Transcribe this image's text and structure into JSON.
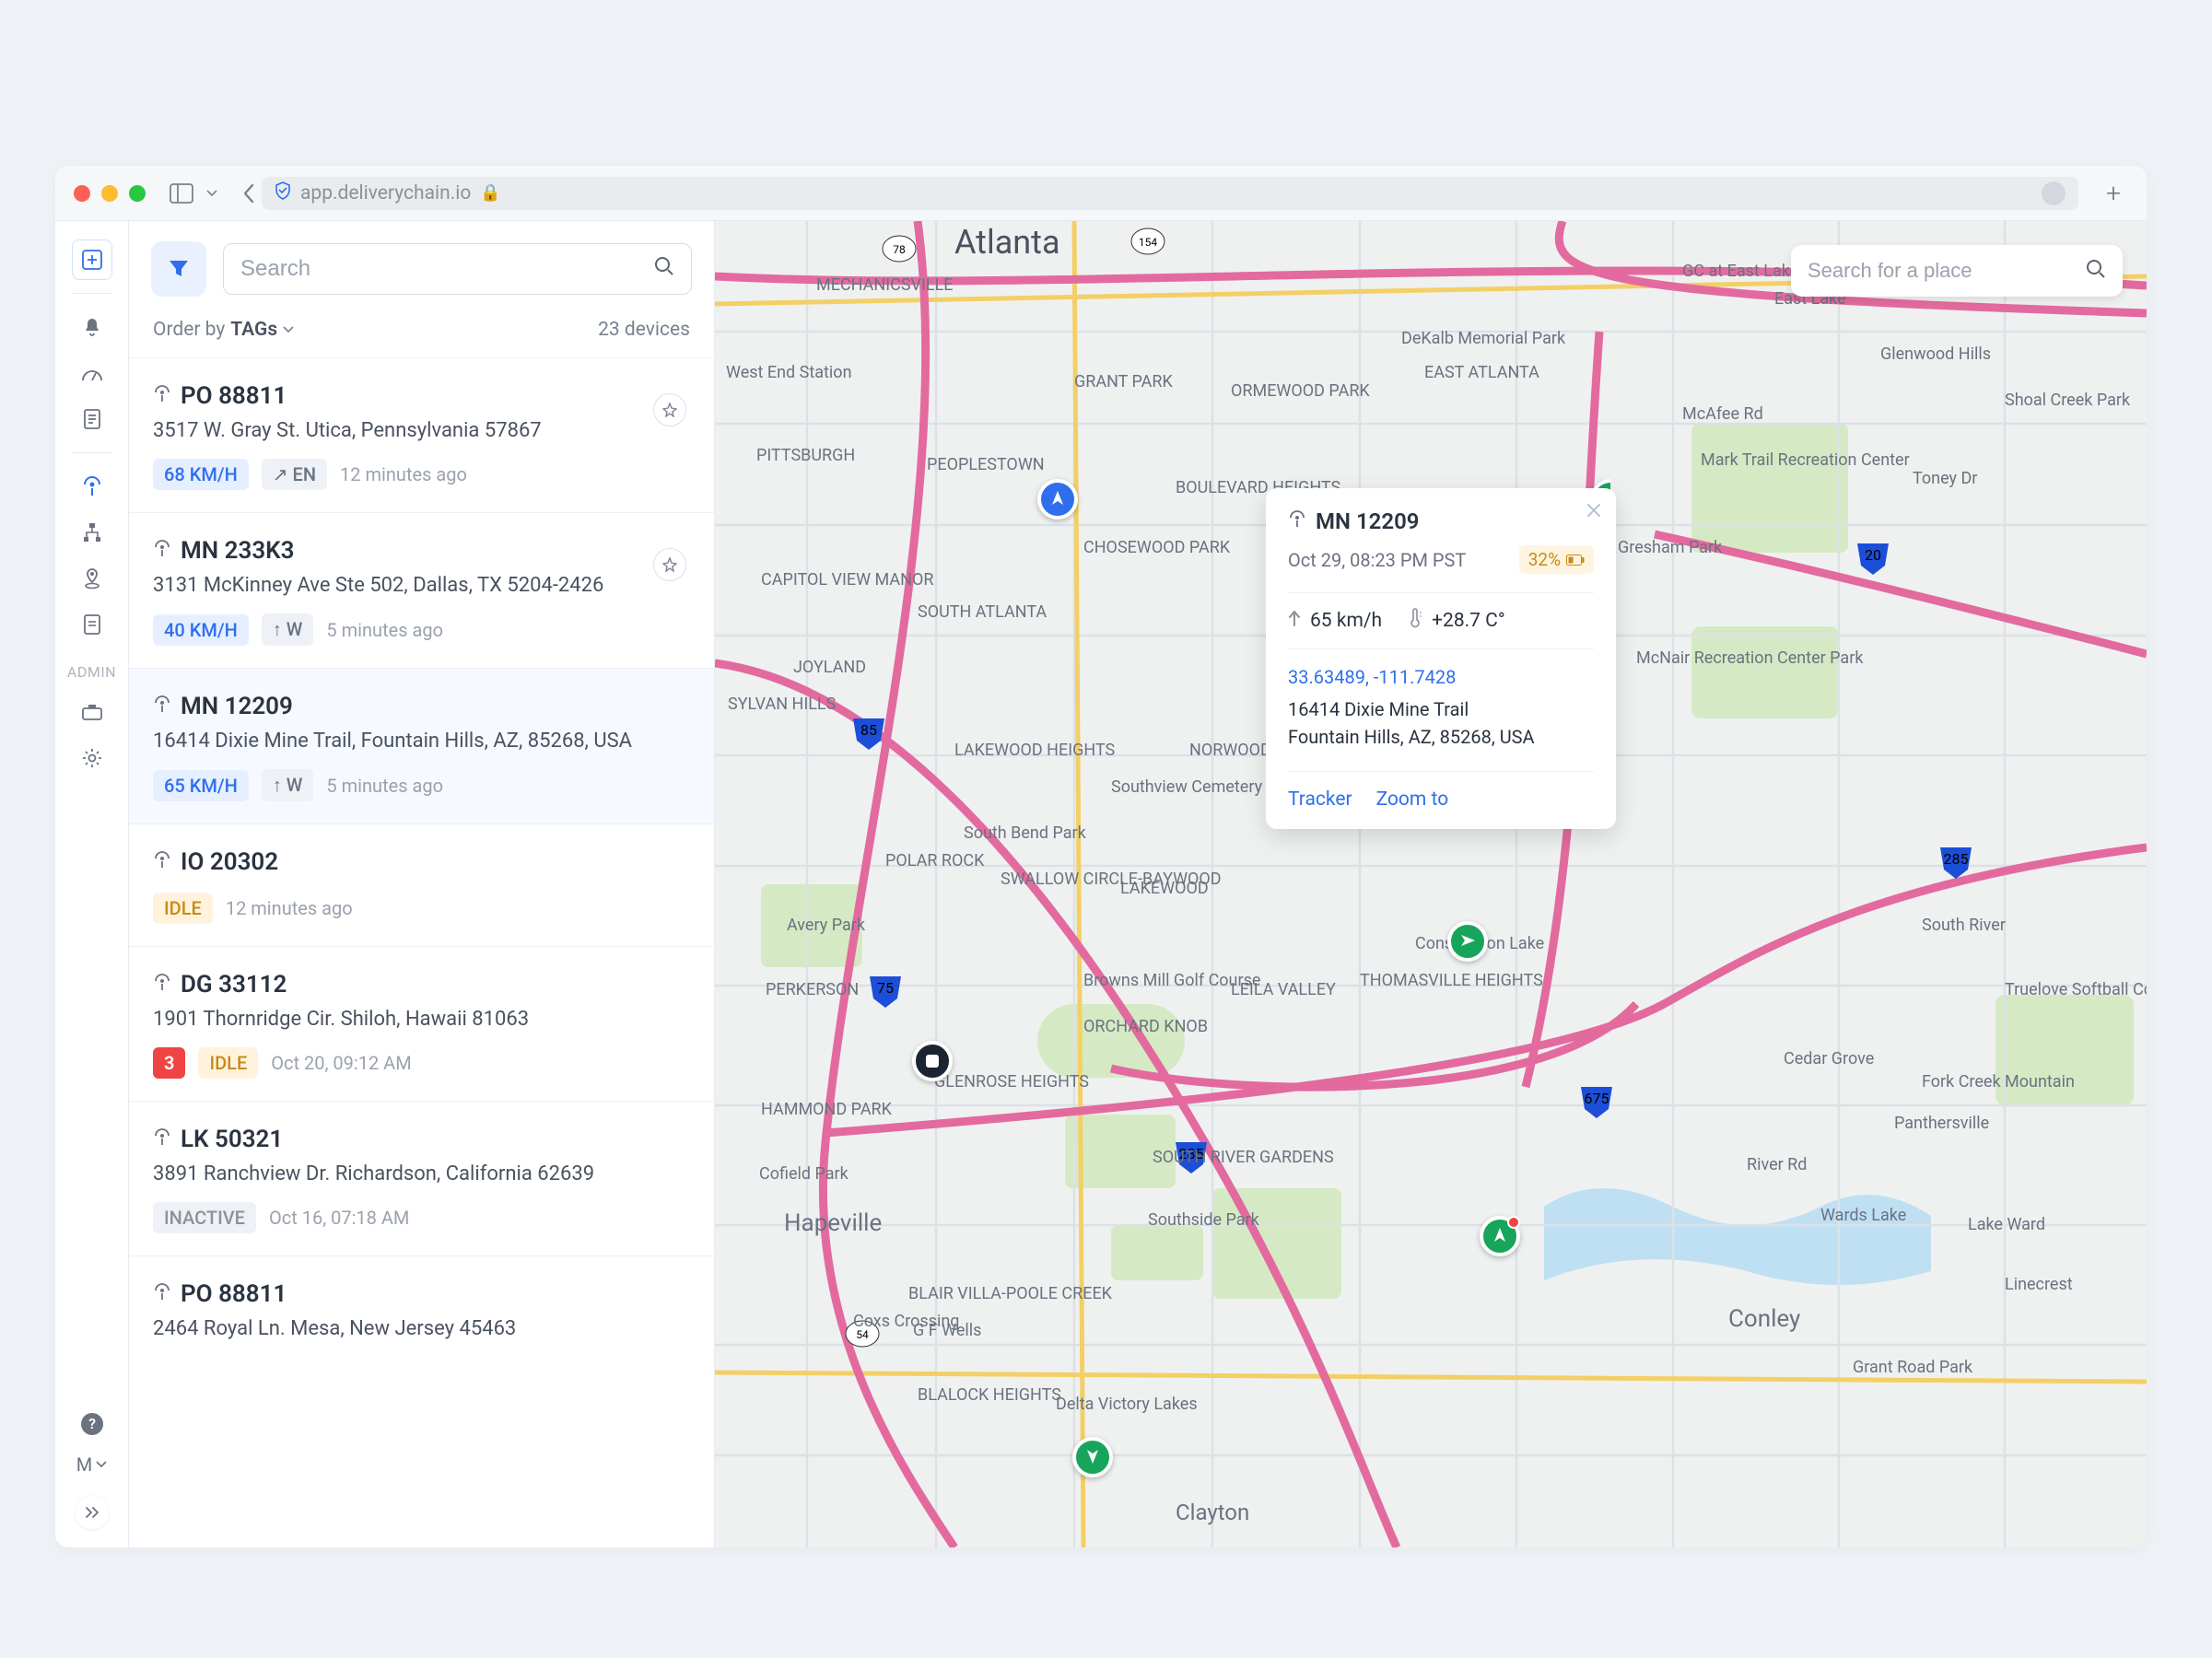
{
  "browser": {
    "url": "app.deliverychain.io"
  },
  "side": {
    "search_placeholder": "Search",
    "order_label": "Order by",
    "order_value": "TAGs",
    "device_count": "23 devices",
    "admin_label": "ADMIN",
    "user_initial": "M"
  },
  "map_search": {
    "placeholder": "Search for a place"
  },
  "devices": [
    {
      "id": "PO 88811",
      "addr": "3517 W. Gray St. Utica, Pennsylvania 57867",
      "speed": "68 KM/H",
      "dir": "↗ EN",
      "time": "12 minutes ago",
      "pin": true,
      "state": "moving"
    },
    {
      "id": "MN 233K3",
      "addr": "3131 McKinney Ave Ste 502, Dallas, TX 5204-2426",
      "speed": "40 KM/H",
      "dir": "↑ W",
      "time": "5 minutes ago",
      "pin": true,
      "state": "moving"
    },
    {
      "id": "MN 12209",
      "addr": "16414 Dixie Mine Trail, Fountain Hills, AZ, 85268, USA",
      "speed": "65 KM/H",
      "dir": "↑ W",
      "time": "5 minutes ago",
      "pin": false,
      "state": "moving",
      "selected": true
    },
    {
      "id": "IO 20302",
      "addr": "",
      "idle": "IDLE",
      "time": "12 minutes ago",
      "state": "idle"
    },
    {
      "id": "DG 33112",
      "addr": "1901 Thornridge Cir. Shiloh, Hawaii 81063",
      "alert": "3",
      "idle": "IDLE",
      "time": "Oct 20, 09:12 AM",
      "state": "idle"
    },
    {
      "id": "LK 50321",
      "addr": "3891 Ranchview Dr. Richardson, California 62639",
      "inactive": "INACTIVE",
      "time": "Oct 16, 07:18 AM",
      "state": "inactive"
    },
    {
      "id": "PO 88811",
      "addr": "2464 Royal Ln. Mesa, New Jersey 45463",
      "state": ""
    }
  ],
  "popup": {
    "id": "MN 12209",
    "time": "Oct 29, 08:23 PM PST",
    "battery": "32%",
    "speed": "65 km/h",
    "temp": "+28.7 C°",
    "coords": "33.63489, -111.7428",
    "addr1": "16414 Dixie Mine Trail",
    "addr2": "Fountain Hills, AZ, 85268, USA",
    "action_tracker": "Tracker",
    "action_zoom": "Zoom to"
  },
  "map_labels": {
    "atlanta": "Atlanta",
    "hapeville": "Hapeville",
    "conley": "Conley",
    "gfwell": "G F Wells",
    "clayton": "Clayton"
  }
}
